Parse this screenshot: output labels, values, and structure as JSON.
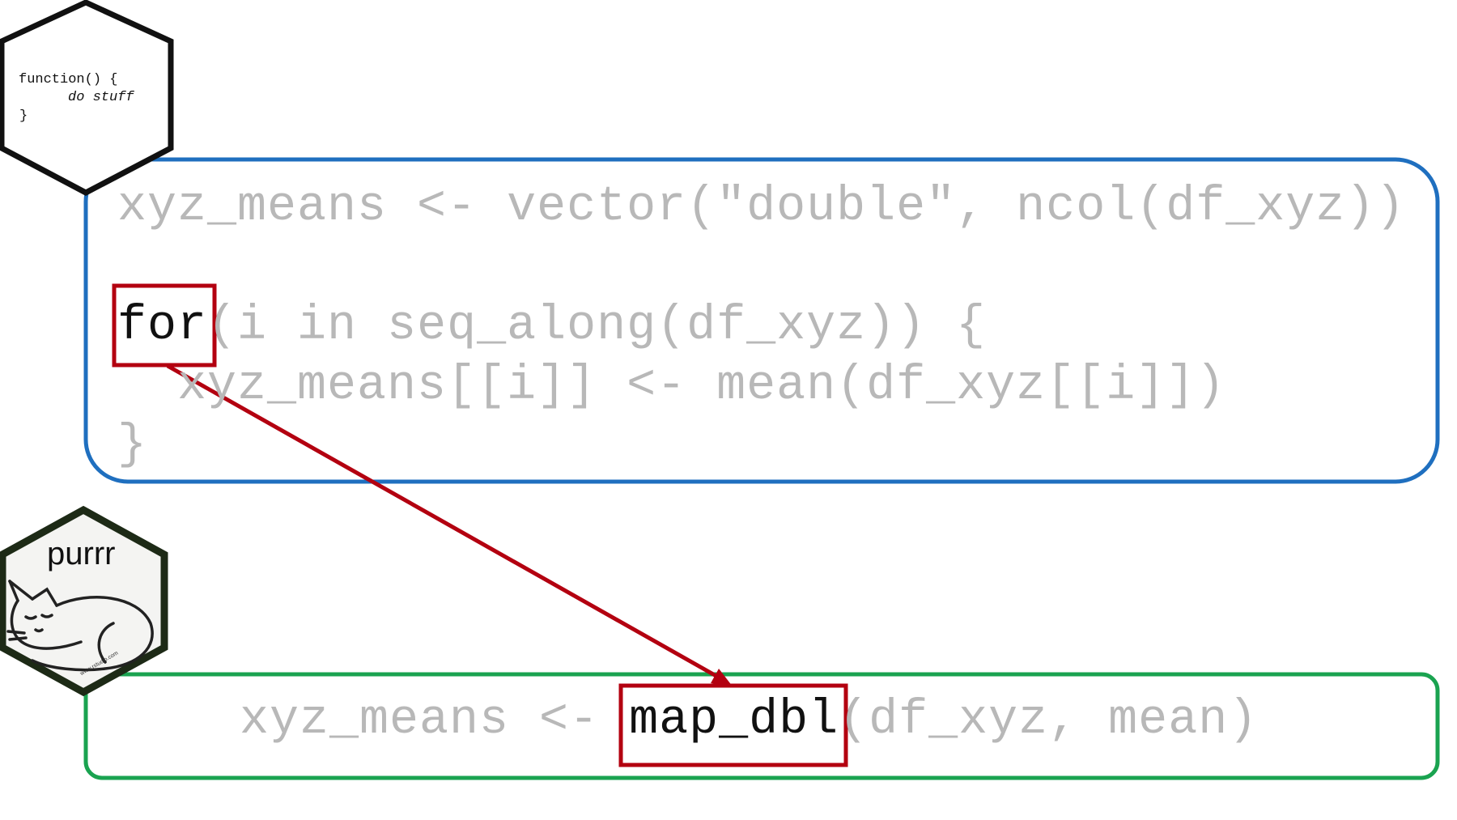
{
  "function_hex": {
    "line1": "function() {",
    "line2": "do stuff",
    "line3": "}"
  },
  "for_loop": {
    "line1": "xyz_means <- vector(\"double\", ncol(df_xyz))",
    "line2_keyword": "for",
    "line2_rest": "(i in seq_along(df_xyz)) {",
    "line3": "  xyz_means[[i]] <- mean(df_xyz[[i]])",
    "line4": "}"
  },
  "purrr_hex": {
    "label": "purrr",
    "small_text": "www.rstudio.com"
  },
  "map_call": {
    "prefix": "xyz_means <- ",
    "keyword": "map_dbl",
    "suffix": "(df_xyz, mean)"
  },
  "colors": {
    "for_loop_border": "#1f6fbf",
    "map_border": "#1aa350",
    "highlight_box": "#b30010",
    "arrow": "#b30010",
    "code_gray": "#b8b8b8"
  }
}
